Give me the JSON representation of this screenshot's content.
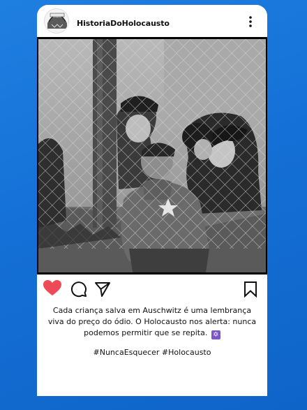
{
  "post": {
    "username": "HistoriaDoHolocausto",
    "caption_lines": [
      "Cada criança salva em Auschwitz é uma lembrança",
      "viva do preço do ódio. O Holocausto nos alerta: nunca",
      "podemos permitir que se repita."
    ],
    "caption_emoji": "✡",
    "hashtags": "#NuncaEsquecer #Holocausto",
    "liked": true
  },
  "colors": {
    "background": "#1470d6",
    "like_heart": "#ed4956",
    "text": "#111111"
  },
  "icons": {
    "avatar": "avatar-logo",
    "more": "more-vertical-icon",
    "like": "heart-icon",
    "comment": "comment-icon",
    "share": "paper-plane-icon",
    "save": "bookmark-icon"
  }
}
